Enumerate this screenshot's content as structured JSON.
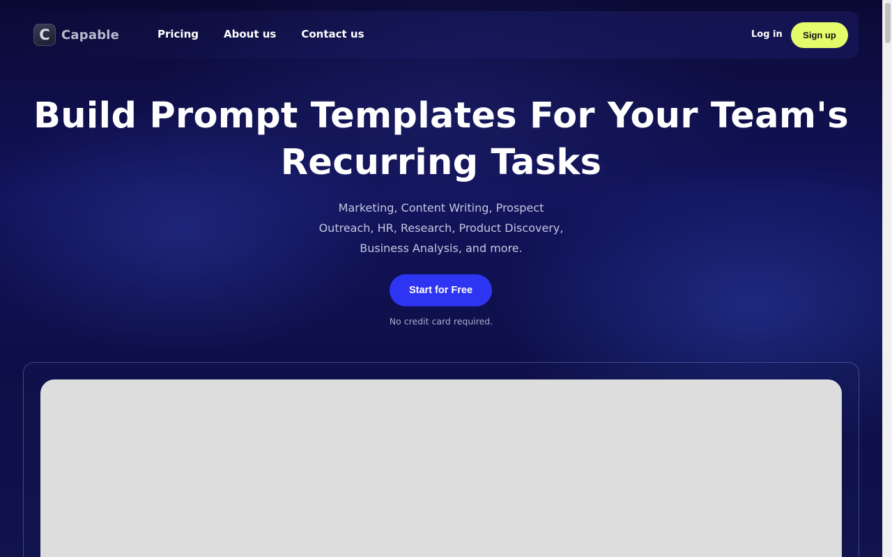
{
  "brand": {
    "name": "Capable",
    "mark": "C"
  },
  "nav": {
    "links": [
      {
        "label": "Pricing"
      },
      {
        "label": "About us"
      },
      {
        "label": "Contact us"
      }
    ],
    "login_label": "Log in",
    "signup_label": "Sign up"
  },
  "hero": {
    "title_line1": "Build Prompt Templates For Your Team's",
    "title_line2": "Recurring Tasks",
    "subtitle_line1": "Marketing, Content Writing, Prospect",
    "subtitle_line2": "Outreach, HR, Research, Product Discovery,",
    "subtitle_line3": "Business Analysis, and more.",
    "cta_label": "Start for Free",
    "note": "No credit card required."
  },
  "colors": {
    "background": "#0d0c3a",
    "accent_primary": "#2d35f2",
    "accent_signup": "#e4fb6a",
    "preview_placeholder": "#dddddd"
  }
}
